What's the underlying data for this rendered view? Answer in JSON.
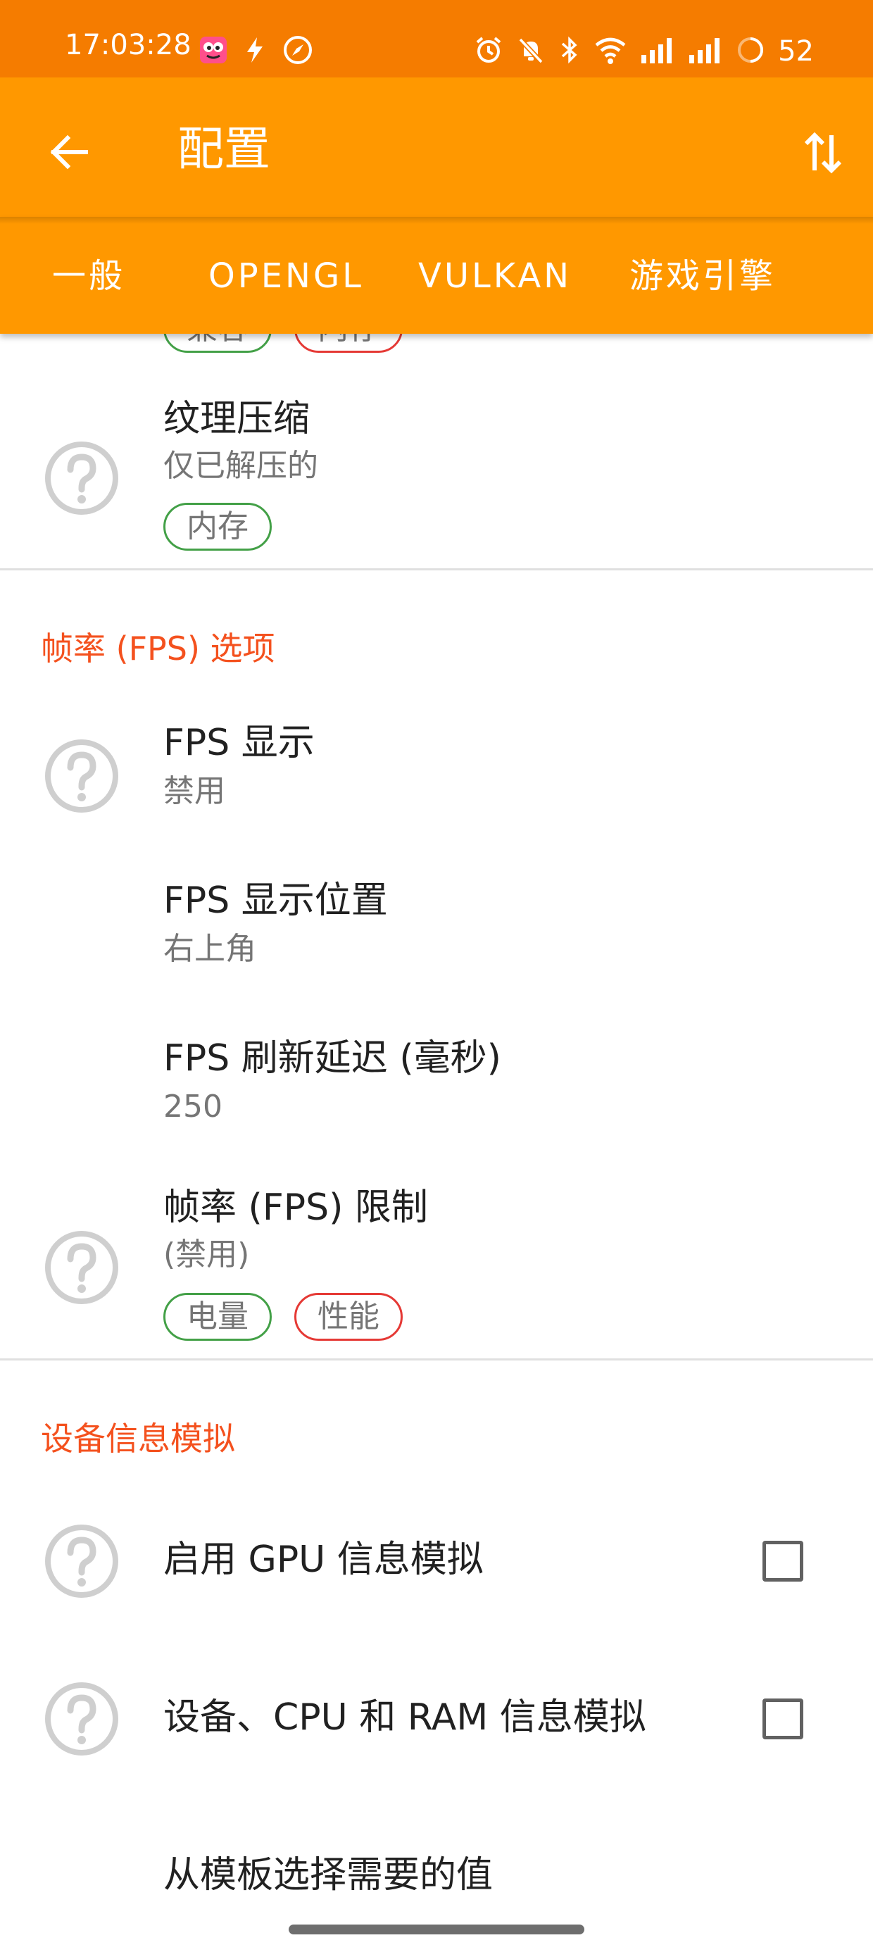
{
  "status_bar": {
    "time": "17:03:28",
    "battery_level": "52",
    "left_icons": [
      "app-notification-icon",
      "flash-icon",
      "compass-icon"
    ],
    "right_icons": [
      "alarm-icon",
      "muted-bell-icon",
      "bluetooth-icon",
      "wifi-icon",
      "signal-icon",
      "signal-icon",
      "battery-ring-icon"
    ]
  },
  "app_bar": {
    "title": "配置",
    "back_icon": "arrow-left-icon",
    "action_icon": "sort-arrows-icon"
  },
  "tabs": [
    {
      "label": "一般"
    },
    {
      "label": "OPENGL"
    },
    {
      "label": "VULKAN"
    },
    {
      "label": "游戏引擎"
    }
  ],
  "top_partial": {
    "chips": [
      {
        "label": "兼容",
        "color": "green"
      },
      {
        "label": "内存",
        "color": "red"
      }
    ]
  },
  "texture_compression": {
    "title": "纹理压缩",
    "summary": "仅已解压的",
    "chips": [
      {
        "label": "内存",
        "color": "green"
      }
    ]
  },
  "fps_section": {
    "header": "帧率 (FPS) 选项",
    "items": [
      {
        "title": "FPS 显示",
        "summary": "禁用"
      },
      {
        "title": "FPS 显示位置",
        "summary": "右上角"
      },
      {
        "title": "FPS 刷新延迟 (毫秒)",
        "summary": "250"
      },
      {
        "title": "帧率 (FPS) 限制",
        "summary": "(禁用)"
      }
    ],
    "limit_chips": [
      {
        "label": "电量",
        "color": "green"
      },
      {
        "label": "性能",
        "color": "red"
      }
    ]
  },
  "device_section": {
    "header": "设备信息模拟",
    "items": [
      {
        "title": "启用 GPU 信息模拟",
        "checked": false
      },
      {
        "title": "设备、CPU 和 RAM 信息模拟",
        "checked": false
      },
      {
        "title": "从模板选择需要的值"
      }
    ]
  },
  "colors": {
    "status_bar": "#f57c00",
    "app_bar": "#ff9800",
    "section_header": "#f4511e",
    "chip_green": "#43a047",
    "chip_red": "#e53935"
  }
}
